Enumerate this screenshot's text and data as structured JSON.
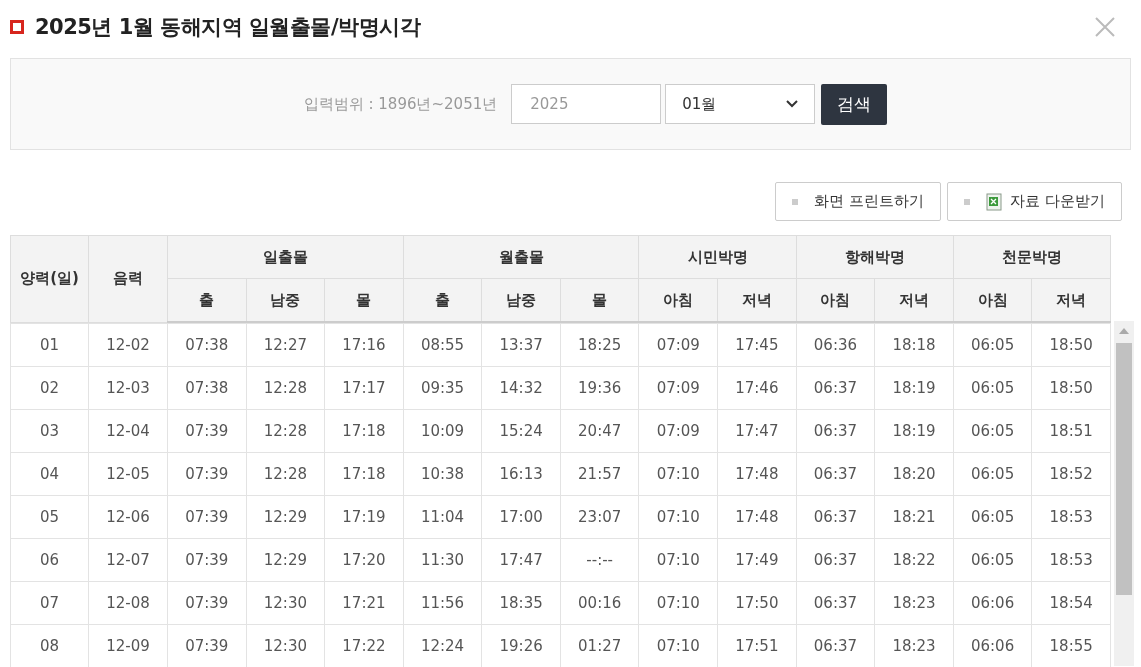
{
  "title": "2025년 1월 동해지역 일월출몰/박명시각",
  "search": {
    "range_label": "입력범위 : 1896년~2051년",
    "year_value": "2025",
    "month_value": "01월",
    "button": "검색"
  },
  "actions": [
    {
      "kind": "print",
      "label": "화면 프린트하기"
    },
    {
      "kind": "download",
      "label": "자료 다운받기"
    }
  ],
  "table": {
    "lead_columns": [
      "양력(일)",
      "음력"
    ],
    "groups": [
      {
        "label": "일출몰",
        "columns": [
          "출",
          "남중",
          "몰"
        ]
      },
      {
        "label": "월출몰",
        "columns": [
          "출",
          "남중",
          "몰"
        ]
      },
      {
        "label": "시민박명",
        "columns": [
          "아침",
          "저녁"
        ]
      },
      {
        "label": "항해박명",
        "columns": [
          "아침",
          "저녁"
        ]
      },
      {
        "label": "천문박명",
        "columns": [
          "아침",
          "저녁"
        ]
      }
    ],
    "rows": [
      [
        "01",
        "12-02",
        "07:38",
        "12:27",
        "17:16",
        "08:55",
        "13:37",
        "18:25",
        "07:09",
        "17:45",
        "06:36",
        "18:18",
        "06:05",
        "18:50"
      ],
      [
        "02",
        "12-03",
        "07:38",
        "12:28",
        "17:17",
        "09:35",
        "14:32",
        "19:36",
        "07:09",
        "17:46",
        "06:37",
        "18:19",
        "06:05",
        "18:50"
      ],
      [
        "03",
        "12-04",
        "07:39",
        "12:28",
        "17:18",
        "10:09",
        "15:24",
        "20:47",
        "07:09",
        "17:47",
        "06:37",
        "18:19",
        "06:05",
        "18:51"
      ],
      [
        "04",
        "12-05",
        "07:39",
        "12:28",
        "17:18",
        "10:38",
        "16:13",
        "21:57",
        "07:10",
        "17:48",
        "06:37",
        "18:20",
        "06:05",
        "18:52"
      ],
      [
        "05",
        "12-06",
        "07:39",
        "12:29",
        "17:19",
        "11:04",
        "17:00",
        "23:07",
        "07:10",
        "17:48",
        "06:37",
        "18:21",
        "06:05",
        "18:53"
      ],
      [
        "06",
        "12-07",
        "07:39",
        "12:29",
        "17:20",
        "11:30",
        "17:47",
        "--:--",
        "07:10",
        "17:49",
        "06:37",
        "18:22",
        "06:05",
        "18:53"
      ],
      [
        "07",
        "12-08",
        "07:39",
        "12:30",
        "17:21",
        "11:56",
        "18:35",
        "00:16",
        "07:10",
        "17:50",
        "06:37",
        "18:23",
        "06:06",
        "18:54"
      ],
      [
        "08",
        "12-09",
        "07:39",
        "12:30",
        "17:22",
        "12:24",
        "19:26",
        "01:27",
        "07:10",
        "17:51",
        "06:37",
        "18:23",
        "06:06",
        "18:55"
      ]
    ]
  }
}
